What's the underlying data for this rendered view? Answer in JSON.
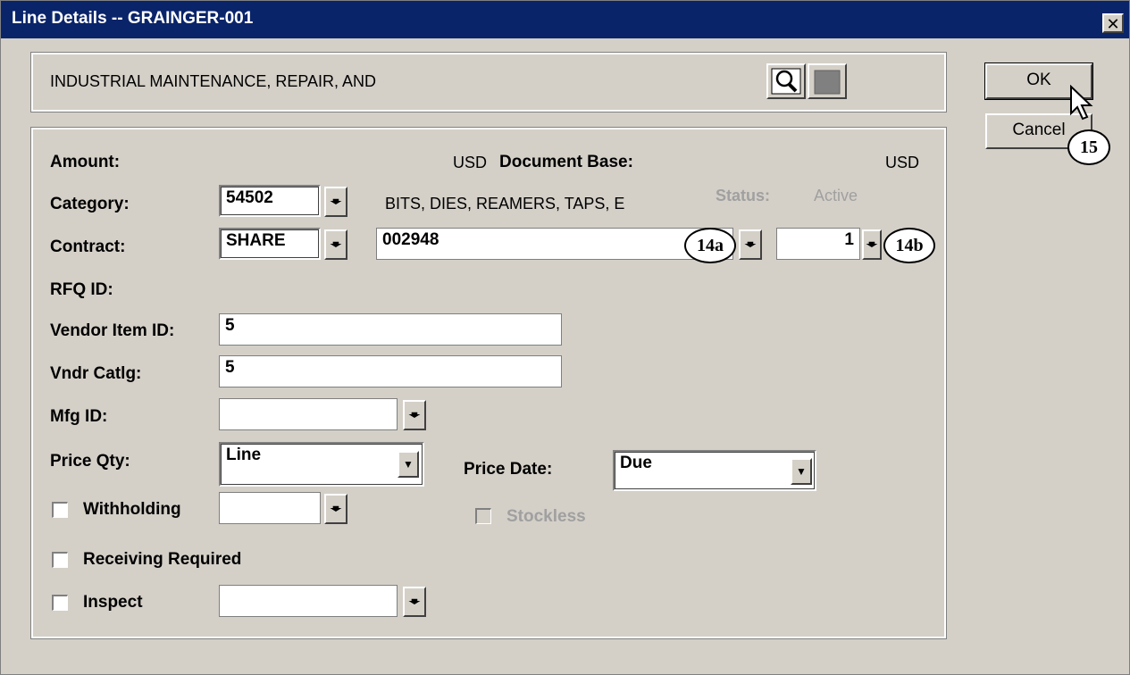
{
  "window": {
    "title": "Line Details -- GRAINGER-001",
    "close_symbol": "✕"
  },
  "description": {
    "text": "INDUSTRIAL MAINTENANCE, REPAIR, AND"
  },
  "icons": {
    "search": "magnifier-icon",
    "palette": "color-square-icon",
    "dropdown": "down-arrow-icon"
  },
  "buttons": {
    "ok": "OK",
    "cancel": "Cancel"
  },
  "callouts": {
    "c14a": "14a",
    "c14b": "14b",
    "c15": "15"
  },
  "form": {
    "amount_label": "Amount:",
    "amount_currency": "USD",
    "doc_base_label": "Document Base:",
    "doc_base_currency": "USD",
    "category_label": "Category:",
    "category_value": "54502",
    "category_desc": "BITS, DIES, REAMERS, TAPS, E",
    "status_label": "Status:",
    "status_value": "Active",
    "contract_label": "Contract:",
    "contract_type": "SHARE",
    "contract_id": "002948",
    "contract_line": "1",
    "rfq_label": "RFQ ID:",
    "vendor_item_label": "Vendor Item ID:",
    "vendor_item_value": "5",
    "vndr_catlg_label": "Vndr Catlg:",
    "vndr_catlg_value": "5",
    "mfg_label": "Mfg ID:",
    "mfg_value": "",
    "price_qty_label": "Price Qty:",
    "price_qty_value": "Line",
    "price_date_label": "Price Date:",
    "price_date_value": "Due",
    "withholding_label": "Withholding",
    "withholding_checked": false,
    "withholding_value": "",
    "stockless_label": "Stockless",
    "stockless_checked": false,
    "receiving_label": "Receiving Required",
    "receiving_checked": false,
    "inspect_label": "Inspect",
    "inspect_checked": false,
    "inspect_value": ""
  },
  "colors": {
    "titlebar": "#0a246a",
    "face": "#d4d0c8",
    "disabled_text": "#a0a0a0"
  }
}
